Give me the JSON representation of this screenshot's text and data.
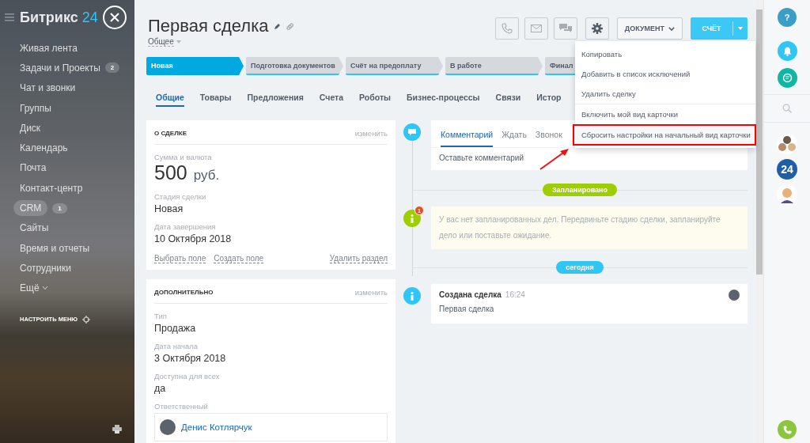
{
  "sidebar": {
    "logo": {
      "name": "Битрикс",
      "number": "24"
    },
    "items": [
      {
        "label": "Живая лента",
        "selected": false
      },
      {
        "label": "Задачи и Проекты",
        "counter": "2",
        "selected": false
      },
      {
        "label": "Чат и звонки",
        "selected": false
      },
      {
        "label": "Группы",
        "selected": false
      },
      {
        "label": "Диск",
        "selected": false
      },
      {
        "label": "Календарь",
        "selected": false
      },
      {
        "label": "Почта",
        "selected": false
      },
      {
        "label": "Контакт-центр",
        "selected": false
      },
      {
        "label": "CRM",
        "counter": "1",
        "selected": true
      },
      {
        "label": "Сайты",
        "selected": false
      },
      {
        "label": "Время и отчеты",
        "selected": false
      },
      {
        "label": "Сотрудники",
        "selected": false
      },
      {
        "label": "Ещё",
        "selected": false
      }
    ],
    "settings_label": "НАСТРОИТЬ МЕНЮ"
  },
  "header": {
    "title": "Первая сделка",
    "category": "Общее",
    "document_button": "ДОКУМЕНТ",
    "invoice_button": "СЧЁТ"
  },
  "stages": [
    {
      "label": "Новая",
      "selected": true
    },
    {
      "label": "Подготовка документов",
      "selected": false
    },
    {
      "label": "Счёт на предоплату",
      "selected": false
    },
    {
      "label": "В работе",
      "selected": false
    },
    {
      "label": "Финал",
      "selected": false
    }
  ],
  "tabs": [
    {
      "label": "Общие",
      "selected": true
    },
    {
      "label": "Товары",
      "selected": false
    },
    {
      "label": "Предложения",
      "selected": false
    },
    {
      "label": "Счета",
      "selected": false
    },
    {
      "label": "Роботы",
      "selected": false
    },
    {
      "label": "Бизнес-процессы",
      "selected": false
    },
    {
      "label": "Связи",
      "selected": false
    },
    {
      "label": "Истор",
      "selected": false
    }
  ],
  "cards": [
    {
      "title": "О СДЕЛКЕ",
      "action": "изменить",
      "fields": [
        {
          "kind": "money",
          "label": "Сумма и валюта",
          "value": "500",
          "currency": "руб."
        },
        {
          "kind": "text",
          "label": "Стадия сделки",
          "value": "Новая"
        },
        {
          "kind": "text",
          "label": "Дата завершения",
          "value": "10 Октября 2018"
        }
      ],
      "links": [
        "Выбрать поле",
        "Создать поле"
      ],
      "remove_link": "Удалить раздел"
    },
    {
      "title": "ДОПОЛНИТЕЛЬНО",
      "action": "изменить",
      "fields": [
        {
          "kind": "text",
          "label": "Тип",
          "value": "Продажа"
        },
        {
          "kind": "text",
          "label": "Дата начала",
          "value": "3 Октября 2018"
        },
        {
          "kind": "text",
          "label": "Доступна для всех",
          "value": "да"
        },
        {
          "kind": "person",
          "label": "Ответственный",
          "value": "Денис Котлярчук"
        }
      ]
    }
  ],
  "timeline": {
    "composer": {
      "tabs": [
        {
          "label": "Комментарий",
          "selected": true
        },
        {
          "label": "Ждать",
          "selected": false
        },
        {
          "label": "Звонок",
          "selected": false
        }
      ],
      "placeholder": "Оставьте комментарий"
    },
    "items": [
      {
        "kind": "badge",
        "label": "Запланировано",
        "color": "#9dcf00"
      },
      {
        "kind": "notice",
        "counter": "1",
        "text": "У вас нет запланированных дел. Передвиньте стадию сделки, запланируйте дело или поставьте ожидание."
      },
      {
        "kind": "badge",
        "label": "сегодня",
        "color": "#2fc6f6"
      },
      {
        "kind": "event",
        "title": "Создана сделка",
        "time": "16:24",
        "text": "Первая сделка"
      }
    ]
  },
  "menu": {
    "items": [
      {
        "label": "Копировать",
        "divider_before": false,
        "highlighted": false
      },
      {
        "label": "Добавить в список исключений",
        "divider_before": false,
        "highlighted": false
      },
      {
        "label": "Удалить сделку",
        "divider_before": false,
        "highlighted": false
      },
      {
        "label": "Включить мой вид карточки",
        "divider_before": true,
        "highlighted": false
      },
      {
        "label": "Сбросить настройки на начальный вид карточки",
        "divider_before": false,
        "highlighted": true
      }
    ]
  },
  "right_bar": {
    "help": "?",
    "apps": "24"
  }
}
